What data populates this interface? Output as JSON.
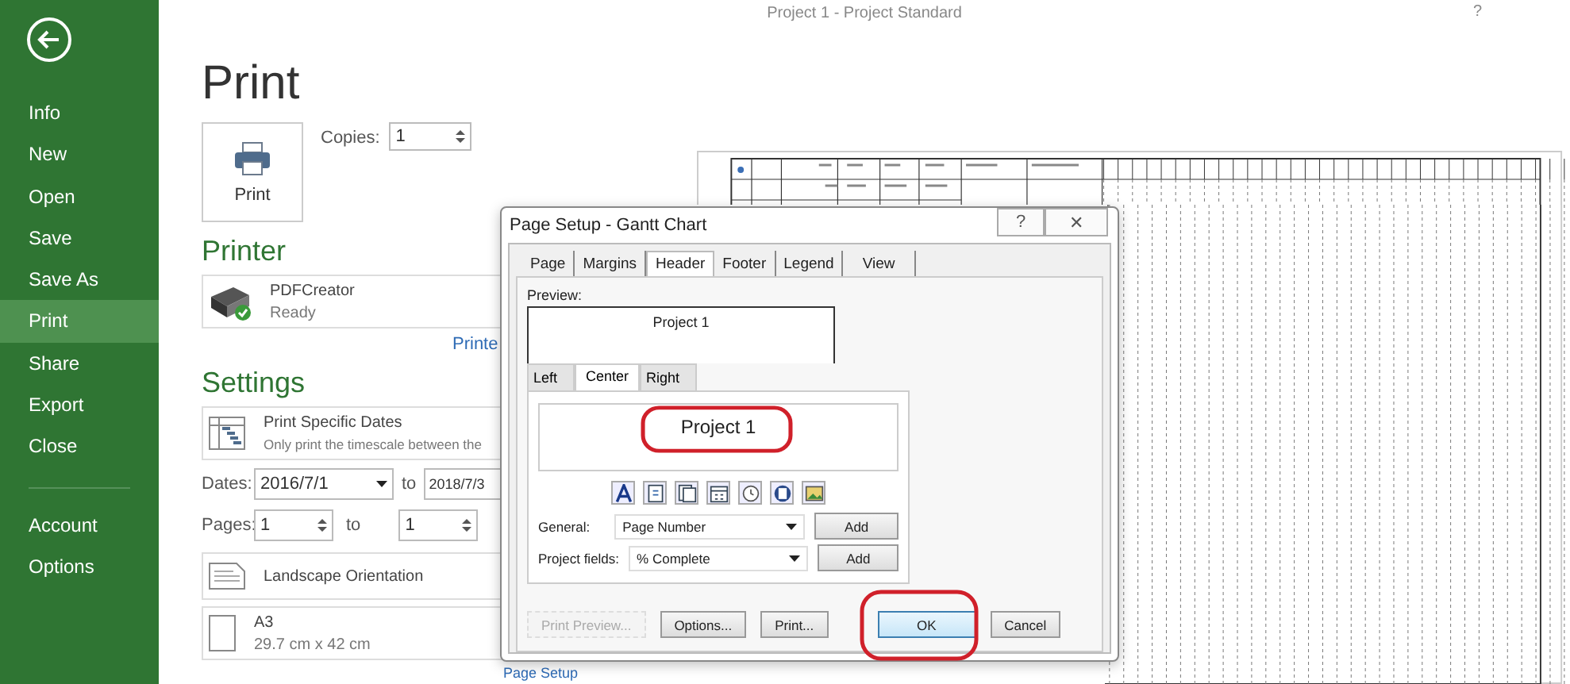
{
  "window": {
    "title": "Project 1 - Project Standard",
    "help": "?"
  },
  "sidebar": {
    "items": [
      {
        "label": "Info",
        "selected": false
      },
      {
        "label": "New",
        "selected": false
      },
      {
        "label": "Open",
        "selected": false
      },
      {
        "label": "Save",
        "selected": false
      },
      {
        "label": "Save As",
        "selected": false
      },
      {
        "label": "Print",
        "selected": true
      },
      {
        "label": "Share",
        "selected": false
      },
      {
        "label": "Export",
        "selected": false
      },
      {
        "label": "Close",
        "selected": false
      }
    ],
    "bottom_items": [
      {
        "label": "Account",
        "selected": false
      },
      {
        "label": "Options",
        "selected": false
      }
    ]
  },
  "print": {
    "heading": "Print",
    "button": "Print",
    "copies_label": "Copies:",
    "copies": "1"
  },
  "printer": {
    "heading": "Printer",
    "name": "PDFCreator",
    "status": "Ready",
    "properties_link": "Printe"
  },
  "settings": {
    "heading": "Settings",
    "range_title": "Print Specific Dates",
    "range_description": "Only print the timescale between the",
    "dates_label": "Dates:",
    "date_from": "2016/7/1",
    "dates_to_label": "to",
    "date_to": "2018/7/3",
    "pages_label": "Pages:",
    "page_from": "1",
    "pages_to_label": "to",
    "page_to": "1",
    "orientation": "Landscape Orientation",
    "paper_name": "A3",
    "paper_size": "29.7 cm x 42 cm",
    "page_setup_link": "Page Setup"
  },
  "dialog": {
    "title": "Page Setup - Gantt Chart",
    "help": "?",
    "close": "✕",
    "tabs": [
      {
        "label": "Page",
        "selected": false
      },
      {
        "label": "Margins",
        "selected": false
      },
      {
        "label": "Header",
        "selected": true
      },
      {
        "label": "Footer",
        "selected": false
      },
      {
        "label": "Legend",
        "selected": false
      },
      {
        "label": "View",
        "selected": false
      }
    ],
    "preview_label": "Preview:",
    "preview_text": "Project 1",
    "align_tabs": [
      {
        "label": "Left",
        "selected": false
      },
      {
        "label": "Center",
        "selected": true
      },
      {
        "label": "Right",
        "selected": false
      }
    ],
    "header_text": "Project 1",
    "general_label": "General:",
    "general_value": "Page Number",
    "general_add": "Add",
    "fields_label": "Project fields:",
    "fields_value": "% Complete",
    "fields_add": "Add",
    "buttons": [
      {
        "label": "Print Preview...",
        "disabled": true,
        "default": false
      },
      {
        "label": "Options...",
        "disabled": false,
        "default": false
      },
      {
        "label": "Print...",
        "disabled": false,
        "default": false
      },
      {
        "label": "OK",
        "disabled": false,
        "default": true
      },
      {
        "label": "Cancel",
        "disabled": false,
        "default": false
      }
    ]
  }
}
